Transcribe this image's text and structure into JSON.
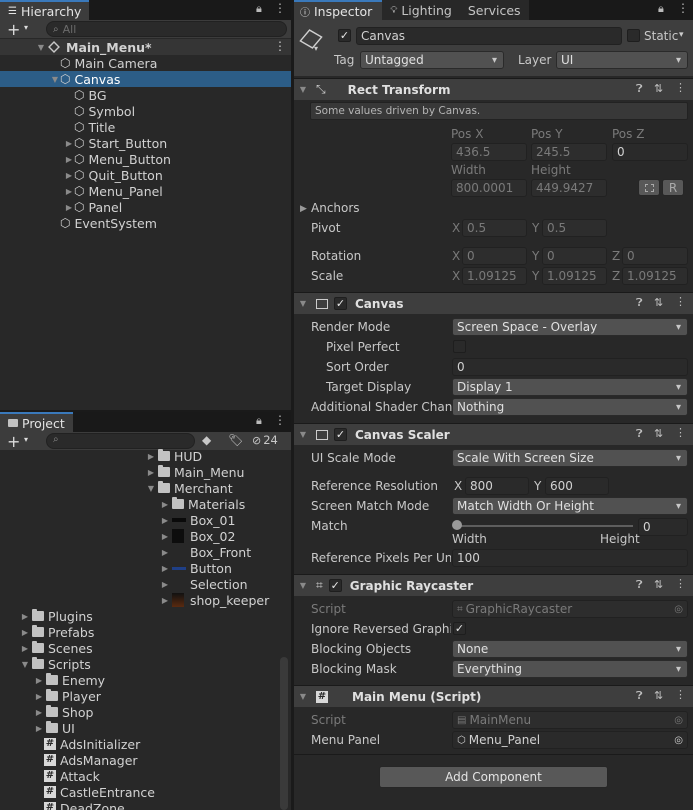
{
  "hierarchy": {
    "tab": "Hierarchy",
    "search_placeholder": "All",
    "scene": "Main_Menu*",
    "items": [
      "Main Camera",
      "Canvas",
      "BG",
      "Symbol",
      "Title",
      "Start_Button",
      "Menu_Button",
      "Quit_Button",
      "Menu_Panel",
      "Panel",
      "EventSystem"
    ]
  },
  "project": {
    "tab": "Project",
    "hidden_count": "24",
    "tree": [
      "HUD",
      "Main_Menu",
      "Merchant",
      "Materials",
      "Box_01",
      "Box_02",
      "Box_Front",
      "Button",
      "Selection",
      "shop_keeper",
      "Plugins",
      "Prefabs",
      "Scenes",
      "Scripts",
      "Enemy",
      "Player",
      "Shop",
      "UI",
      "AdsInitializer",
      "AdsManager",
      "Attack",
      "CastleEntrance",
      "DeadZone"
    ]
  },
  "inspector": {
    "tabs": [
      "Inspector",
      "Lighting",
      "Services"
    ],
    "object_name": "Canvas",
    "static_label": "Static",
    "tag_label": "Tag",
    "tag_value": "Untagged",
    "layer_label": "Layer",
    "layer_value": "UI",
    "rect": {
      "title": "Rect Transform",
      "note": "Some values driven by Canvas.",
      "posx_l": "Pos X",
      "posy_l": "Pos Y",
      "posz_l": "Pos Z",
      "posx": "436.5",
      "posy": "245.5",
      "posz": "0",
      "width_l": "Width",
      "height_l": "Height",
      "width": "800.0001",
      "height": "449.9427",
      "r_btn": "R",
      "anchors": "Anchors",
      "pivot": "Pivot",
      "pivot_x": "0.5",
      "pivot_y": "0.5",
      "rotation": "Rotation",
      "rot_x": "0",
      "rot_y": "0",
      "rot_z": "0",
      "scale": "Scale",
      "scale_x": "1.09125",
      "scale_y": "1.09125",
      "scale_z": "1.09125",
      "x": "X",
      "y": "Y",
      "z": "Z"
    },
    "canvas": {
      "title": "Canvas",
      "render_mode_l": "Render Mode",
      "render_mode": "Screen Space - Overlay",
      "pixel_perfect_l": "Pixel Perfect",
      "sort_order_l": "Sort Order",
      "sort_order": "0",
      "target_display_l": "Target Display",
      "target_display": "Display 1",
      "shader_l": "Additional Shader Chann",
      "shader": "Nothing"
    },
    "scaler": {
      "title": "Canvas Scaler",
      "mode_l": "UI Scale Mode",
      "mode": "Scale With Screen Size",
      "ref_res_l": "Reference Resolution",
      "ref_x": "800",
      "ref_y": "600",
      "match_mode_l": "Screen Match Mode",
      "match_mode": "Match Width Or Height",
      "match_l": "Match",
      "match": "0",
      "match_level": 0,
      "width_l": "Width",
      "height_l": "Height",
      "ppu_l": "Reference Pixels Per Unit",
      "ppu": "100"
    },
    "raycaster": {
      "title": "Graphic Raycaster",
      "script_l": "Script",
      "script": "GraphicRaycaster",
      "ignore_l": "Ignore Reversed Graphics",
      "blocking_l": "Blocking Objects",
      "blocking": "None",
      "mask_l": "Blocking Mask",
      "mask": "Everything"
    },
    "mainmenu": {
      "title": "Main Menu (Script)",
      "script_l": "Script",
      "script": "MainMenu",
      "panel_l": "Menu Panel",
      "panel": "Menu_Panel"
    },
    "add_component": "Add Component"
  }
}
